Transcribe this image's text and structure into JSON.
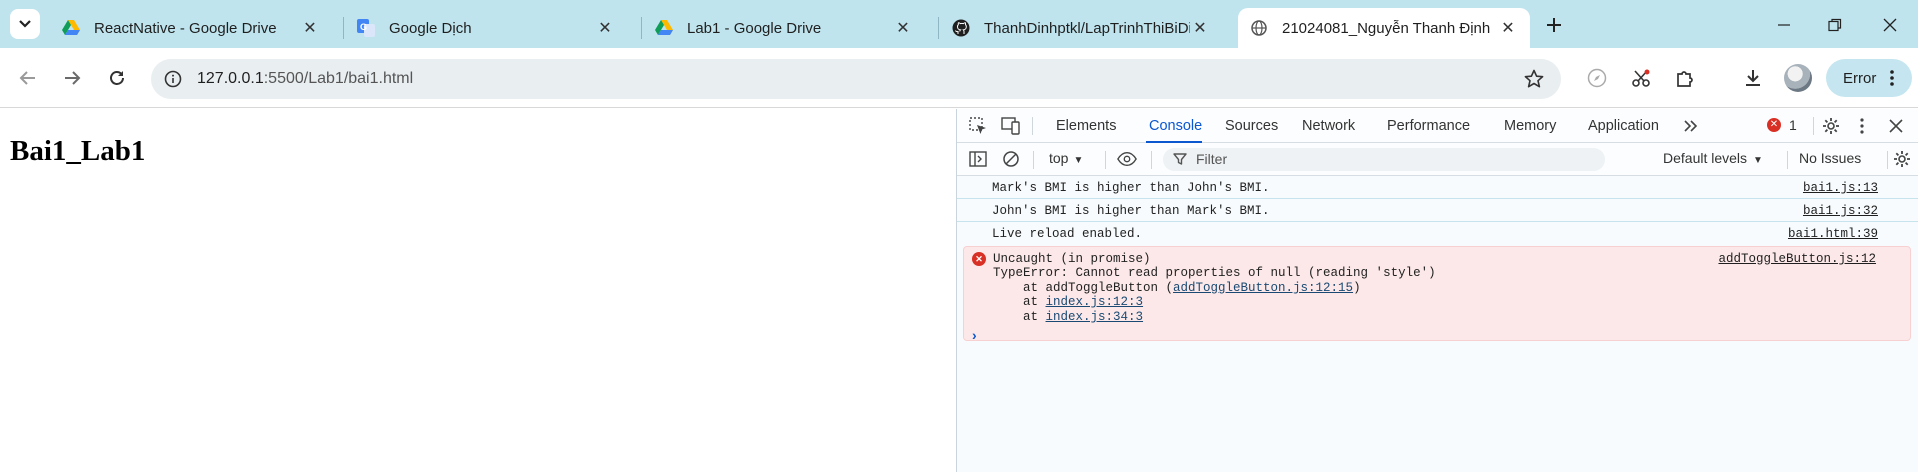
{
  "tabs": [
    {
      "title": "ReactNative - Google Drive",
      "icon": "google-drive-icon",
      "active": false
    },
    {
      "title": "Google Dịch",
      "icon": "google-translate-icon",
      "active": false
    },
    {
      "title": "Lab1 - Google Drive",
      "icon": "google-drive-icon",
      "active": false
    },
    {
      "title": "ThanhDinhptkl/LapTrinhThiBiDi",
      "icon": "github-icon",
      "active": false
    },
    {
      "title": "21024081_Nguyễn Thanh Định",
      "icon": "globe-icon",
      "active": true
    }
  ],
  "toolbar": {
    "url_host": "127.0.0.1",
    "url_path": ":5500/Lab1/bai1.html",
    "error_label": "Error"
  },
  "page": {
    "heading": "Bai1_Lab1"
  },
  "devtools": {
    "tabs": [
      "Elements",
      "Console",
      "Sources",
      "Network",
      "Performance",
      "Memory",
      "Application"
    ],
    "active_tab": "Console",
    "error_count": "1",
    "context": "top",
    "filter_placeholder": "Filter",
    "levels": "Default levels",
    "issues": "No Issues"
  },
  "console": {
    "logs": [
      {
        "text": "Mark's BMI is higher than John's BMI.",
        "source": "bai1.js:13"
      },
      {
        "text": "John's BMI is higher than Mark's BMI.",
        "source": "bai1.js:32"
      },
      {
        "text": "Live reload enabled.",
        "source": "bai1.html:39"
      }
    ],
    "error": {
      "title": "Uncaught (in promise)",
      "message": "TypeError: Cannot read properties of null (reading 'style')",
      "source": "addToggleButton.js:12",
      "stack_1_prefix": "    at addToggleButton (",
      "stack_1_link": "addToggleButton.js:12:15",
      "stack_1_suffix": ")",
      "stack_2_prefix": "    at ",
      "stack_2_link": "index.js:12:3",
      "stack_3_prefix": "    at ",
      "stack_3_link": "index.js:34:3"
    },
    "prompt": "›"
  },
  "colors": {
    "tabstrip": "#bfe4ee",
    "accent": "#0b57d0",
    "error_bg": "#fce8e8",
    "error_icon": "#d93025"
  }
}
